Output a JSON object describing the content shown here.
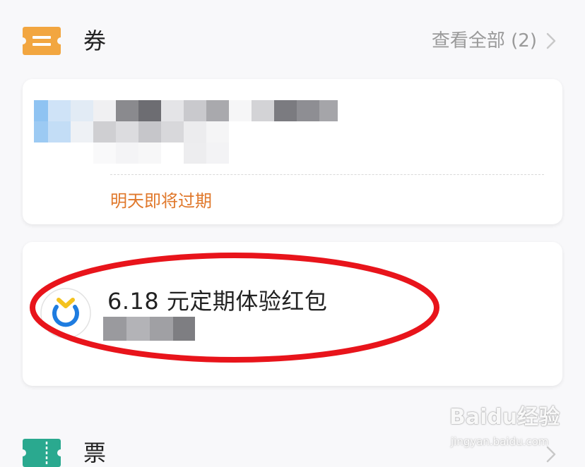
{
  "coupons_section": {
    "title": "券",
    "view_all_label": "查看全部 (2)",
    "icon": "ticket-stripe-icon",
    "icon_color": "#f2a640"
  },
  "coupon_cards": [
    {
      "expire_text": "明天即将过期",
      "expire_color": "#e0782b"
    },
    {
      "title": "6.18 元定期体验红包",
      "icon": "clock-coin-icon"
    }
  ],
  "tickets_section": {
    "title": "票",
    "icon": "ticket-perforated-icon",
    "icon_color": "#2aa98f"
  },
  "watermark": {
    "logo_text": "Baidu经验",
    "url_text": "jingyan.baidu.com"
  },
  "highlight_color": "#e8141b"
}
